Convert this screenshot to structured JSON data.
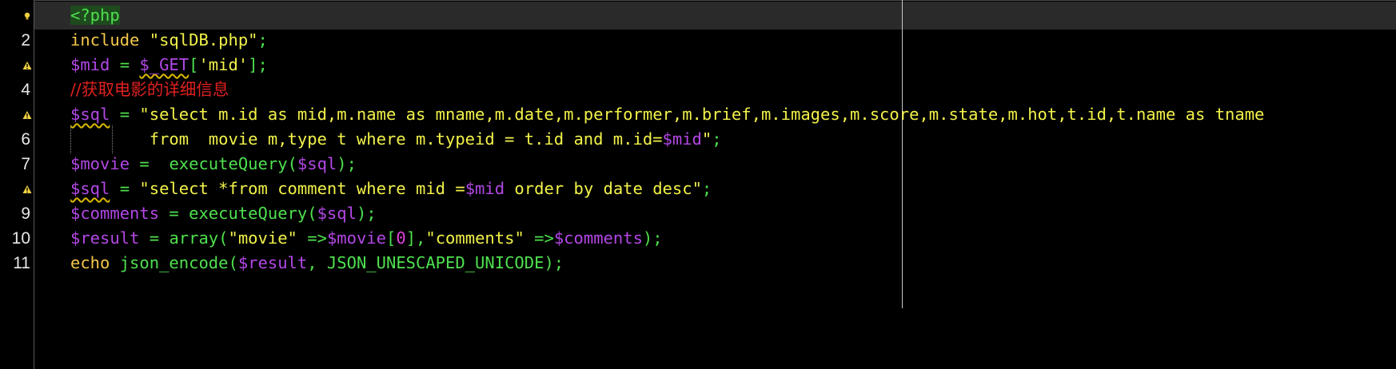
{
  "editor": {
    "language": "php",
    "colors": {
      "background": "#000000",
      "current_line": "#2a2a2a",
      "keyword": "#f5c84a",
      "string": "#f2f24a",
      "variable": "#b347e6",
      "function": "#4ee04e",
      "comment": "#e02020"
    },
    "markers": {
      "line1": "bulb-icon",
      "warning": "warning-icon"
    }
  },
  "lines": {
    "l2": "2",
    "l4": "4",
    "l6": "6",
    "l7": "7",
    "l9": "9",
    "l10": "10",
    "l11": "11"
  },
  "code": {
    "l1": {
      "tag": "<?php"
    },
    "l2": {
      "kw": "include",
      "str": "\"sqlDB.php\"",
      "end": ";"
    },
    "l3": {
      "var": "$mid",
      "eq": " = ",
      "get": "$_GET",
      "open": "[",
      "key": "'mid'",
      "close": "];"
    },
    "l4": {
      "comment": "//获取电影的详细信息"
    },
    "l5": {
      "var": "$sql",
      "eq": " = ",
      "str": "\"select m.id as mid,m.name as mname,m.date,m.performer,m.brief,m.images,m.score,m.state,m.hot,t.id,t.name as tname"
    },
    "l6": {
      "str": "        from  movie m,type t where m.typeid = t.id and m.id=",
      "var": "$mid",
      "str_end": "\"",
      "end": ";"
    },
    "l7": {
      "var": "$movie",
      "eq": " =  ",
      "fn": "executeQuery",
      "open": "(",
      "arg": "$sql",
      "close": ");"
    },
    "l8": {
      "var": "$sql",
      "eq": " = ",
      "str": "\"select *from comment where mid =",
      "var2": "$mid",
      "str2": " order by date desc\"",
      "end": ";"
    },
    "l9": {
      "var": "$comments",
      "eq": " = ",
      "fn": "executeQuery",
      "open": "(",
      "arg": "$sql",
      "close": ");"
    },
    "l10": {
      "var": "$result",
      "eq": " = ",
      "fn": "array",
      "open": "(",
      "s1": "\"movie\"",
      "arrow1": " =>",
      "v1": "$movie",
      "b1": "[",
      "num": "0",
      "b2": "]",
      "comma": ",",
      "s2": "\"comments\"",
      "arrow2": " =>",
      "v2": "$comments",
      "close": ");"
    },
    "l11": {
      "kw": "echo",
      "fn": " json_encode",
      "open": "(",
      "arg": "$result",
      "comma": ", ",
      "const": "JSON_UNESCAPED_UNICODE",
      "close": ");"
    }
  }
}
